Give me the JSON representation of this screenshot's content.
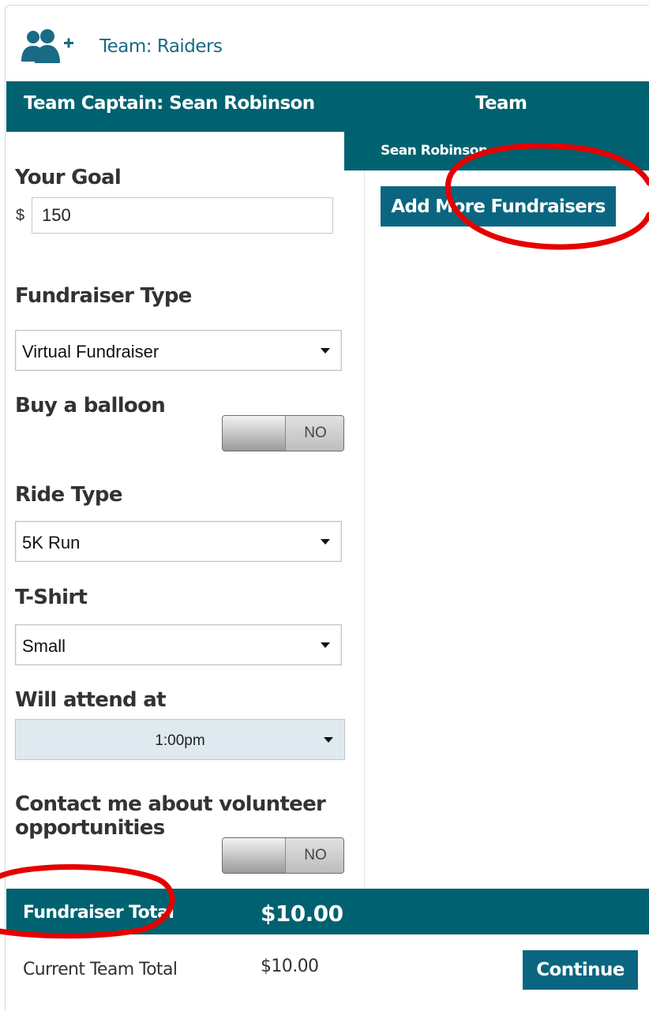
{
  "header": {
    "icon": "add-users-icon",
    "team_name": "Team: Raiders"
  },
  "tabs": {
    "captain": "Team Captain: Sean Robinson",
    "team": "Team",
    "member": "Sean Robinson"
  },
  "team_panel": {
    "add_button": "Add More Fundraisers"
  },
  "form": {
    "goal_label": "Your Goal",
    "currency": "$",
    "goal_value": "150",
    "fundraiser_type_label": "Fundraiser Type",
    "fundraiser_type_value": "Virtual Fundraiser",
    "balloon_label": "Buy a balloon",
    "balloon_toggle": "NO",
    "ride_type_label": "Ride Type",
    "ride_type_value": "5K Run",
    "tshirt_label": "T-Shirt",
    "tshirt_value": "Small",
    "attend_label": "Will attend at",
    "attend_value": "1:00pm",
    "volunteer_label_line1": "Contact me about volunteer",
    "volunteer_label_line2": "opportunities",
    "volunteer_toggle": "NO"
  },
  "totals": {
    "fundraiser_total_label": "Fundraiser Total",
    "fundraiser_total_value": "$10.00",
    "team_total_label": "Current Team Total",
    "team_total_value": "$10.00",
    "continue_button": "Continue"
  },
  "colors": {
    "teal": "#006270",
    "button": "#0a6680",
    "annotation_red": "#e60000"
  }
}
